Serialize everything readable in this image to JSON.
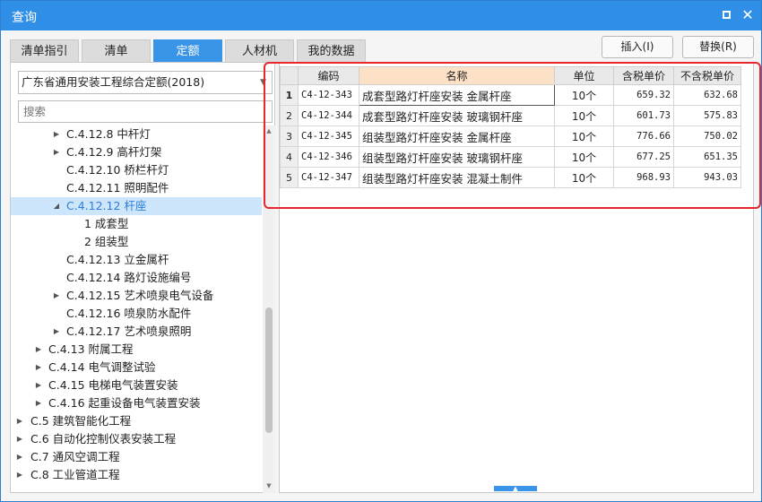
{
  "window": {
    "title": "查询",
    "maximize_icon": "maximize-icon",
    "close_icon": "close-icon",
    "close_glyph": "✕"
  },
  "tabs": [
    {
      "label": "清单指引",
      "active": false
    },
    {
      "label": "清单",
      "active": false
    },
    {
      "label": "定额",
      "active": true
    },
    {
      "label": "人材机",
      "active": false
    },
    {
      "label": "我的数据",
      "active": false
    }
  ],
  "toolbar": {
    "insert_label": "插入(I)",
    "replace_label": "替换(R)"
  },
  "left": {
    "quota_library": "广东省通用安装工程综合定额(2018)",
    "search_placeholder": "搜索",
    "tree": [
      {
        "label": "C.4.12.8 中杆灯",
        "expander": "collapsed"
      },
      {
        "label": "C.4.12.9 高杆灯架",
        "expander": "collapsed"
      },
      {
        "label": "C.4.12.10 桥栏杆灯",
        "expander": "none"
      },
      {
        "label": "C.4.12.11 照明配件",
        "expander": "none"
      },
      {
        "label": "C.4.12.12 杆座",
        "expander": "expanded",
        "selected": true
      },
      {
        "label": "1 成套型",
        "expander": "none"
      },
      {
        "label": "2 组装型",
        "expander": "none"
      },
      {
        "label": "C.4.12.13 立金属杆",
        "expander": "none"
      },
      {
        "label": "C.4.12.14 路灯设施编号",
        "expander": "none"
      },
      {
        "label": "C.4.12.15 艺术喷泉电气设备",
        "expander": "collapsed"
      },
      {
        "label": "C.4.12.16 喷泉防水配件",
        "expander": "none"
      },
      {
        "label": "C.4.12.17 艺术喷泉照明",
        "expander": "collapsed"
      },
      {
        "label": "C.4.13 附属工程",
        "expander": "collapsed"
      },
      {
        "label": "C.4.14 电气调整试验",
        "expander": "collapsed"
      },
      {
        "label": "C.4.15 电梯电气装置安装",
        "expander": "collapsed"
      },
      {
        "label": "C.4.16 起重设备电气装置安装",
        "expander": "collapsed"
      },
      {
        "label": "C.5 建筑智能化工程",
        "expander": "collapsed"
      },
      {
        "label": "C.6 自动化控制仪表安装工程",
        "expander": "collapsed"
      },
      {
        "label": "C.7 通风空调工程",
        "expander": "collapsed"
      },
      {
        "label": "C.8 工业管道工程",
        "expander": "collapsed"
      }
    ]
  },
  "grid": {
    "headers": {
      "code": "编码",
      "name": "名称",
      "unit": "单位",
      "tax_price": "含税单价",
      "notax_price": "不含税单价"
    },
    "rows": [
      {
        "num": "1",
        "code": "C4-12-343",
        "name": "成套型路灯杆座安装 金属杆座",
        "unit": "10个",
        "tax_price": "659.32",
        "notax_price": "632.68"
      },
      {
        "num": "2",
        "code": "C4-12-344",
        "name": "成套型路灯杆座安装 玻璃钢杆座",
        "unit": "10个",
        "tax_price": "601.73",
        "notax_price": "575.83"
      },
      {
        "num": "3",
        "code": "C4-12-345",
        "name": "组装型路灯杆座安装 金属杆座",
        "unit": "10个",
        "tax_price": "776.66",
        "notax_price": "750.02"
      },
      {
        "num": "4",
        "code": "C4-12-346",
        "name": "组装型路灯杆座安装 玻璃钢杆座",
        "unit": "10个",
        "tax_price": "677.25",
        "notax_price": "651.35"
      },
      {
        "num": "5",
        "code": "C4-12-347",
        "name": "组装型路灯杆座安装 混凝土制件",
        "unit": "10个",
        "tax_price": "968.93",
        "notax_price": "943.03"
      }
    ]
  },
  "colors": {
    "titlebar": "#2f8ee6",
    "active_tab": "#3a95e8",
    "highlight_box": "#e8262b",
    "selected_tree": "#cde6fb"
  }
}
